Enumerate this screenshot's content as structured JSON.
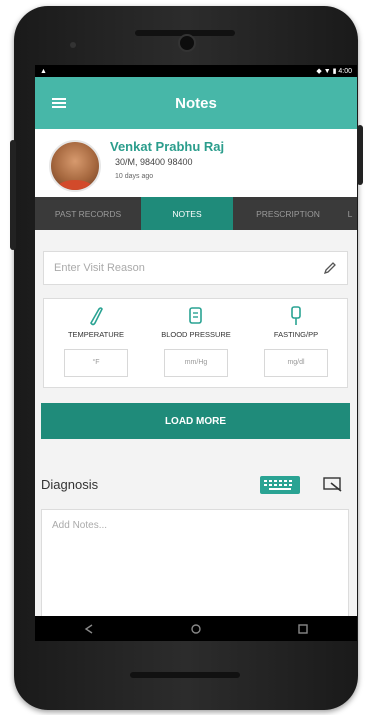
{
  "status_bar": {
    "left_indicator": "▲",
    "right_text": "◆ ▼ ▮ 4:00"
  },
  "app_bar": {
    "title": "Notes",
    "menu_icon": "hamburger-icon"
  },
  "patient": {
    "name": "Venkat Prabhu Raj",
    "info": "30/M,  98400 98400",
    "last_visit": "10 days ago"
  },
  "tabs": [
    {
      "label": "PAST RECORDS",
      "active": false
    },
    {
      "label": "NOTES",
      "active": true
    },
    {
      "label": "PRESCRIPTION",
      "active": false
    },
    {
      "label": "L",
      "active": false
    }
  ],
  "visit_reason": {
    "placeholder": "Enter Visit Reason",
    "icon": "pencil-icon"
  },
  "vitals": [
    {
      "label": "TEMPERATURE",
      "unit": "°F",
      "icon": "thermometer-icon"
    },
    {
      "label": "BLOOD PRESSURE",
      "unit": "mm/Hg",
      "icon": "bp-cuff-icon"
    },
    {
      "label": "FASTING/PP",
      "unit": "mg/dl",
      "icon": "glucose-icon"
    }
  ],
  "load_more_label": "LOAD MORE",
  "diagnosis": {
    "label": "Diagnosis",
    "notes_placeholder": "Add Notes..."
  },
  "colors": {
    "primary": "#47b7a8",
    "accent_dark": "#1f8b7a",
    "tab_bg": "#3a3a3a"
  }
}
